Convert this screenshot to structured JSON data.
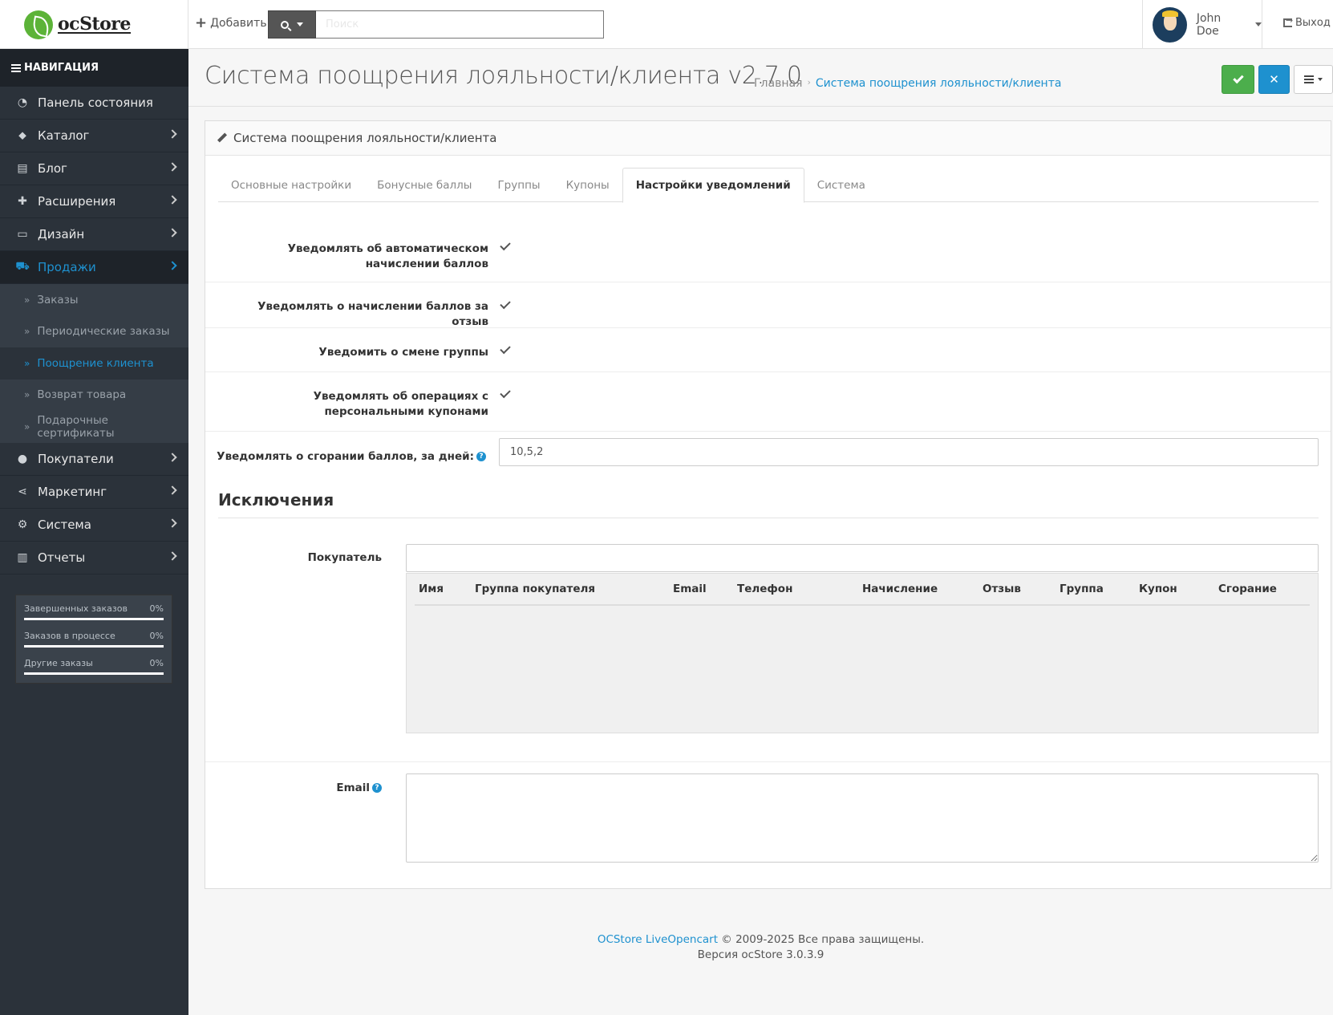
{
  "header": {
    "logo_text": "ocStore",
    "add_label": "Добавить",
    "search_placeholder": "Поиск",
    "user_name": "John Doe",
    "logout_label": "Выход"
  },
  "sidebar": {
    "nav_title": "НАВИГАЦИЯ",
    "items": [
      {
        "label": "Панель состояния",
        "icon": "dashboard-icon"
      },
      {
        "label": "Каталог",
        "icon": "tags-icon"
      },
      {
        "label": "Блог",
        "icon": "book-icon"
      },
      {
        "label": "Расширения",
        "icon": "puzzle-icon"
      },
      {
        "label": "Дизайн",
        "icon": "desktop-icon"
      },
      {
        "label": "Продажи",
        "icon": "cart-icon"
      },
      {
        "label": "Покупатели",
        "icon": "user-icon"
      },
      {
        "label": "Маркетинг",
        "icon": "share-icon"
      },
      {
        "label": "Система",
        "icon": "gear-icon"
      },
      {
        "label": "Отчеты",
        "icon": "bar-chart-icon"
      }
    ],
    "sales_sub": [
      "Заказы",
      "Периодические заказы",
      "Поощрение клиента",
      "Возврат товара",
      "Подарочные сертификаты"
    ],
    "stats": [
      {
        "label": "Завершенных заказов",
        "value": "0%"
      },
      {
        "label": "Заказов в процессе",
        "value": "0%"
      },
      {
        "label": "Другие заказы",
        "value": "0%"
      }
    ]
  },
  "page": {
    "title": "Система поощрения лояльности/клиента v2.7.0",
    "breadcrumb_home": "Главная",
    "breadcrumb_sep": "›",
    "breadcrumb_current": "Система поощрения лояльности/клиента",
    "panel_title": "Система поощрения лояльности/клиента"
  },
  "tabs": [
    "Основные настройки",
    "Бонусные баллы",
    "Группы",
    "Купоны",
    "Настройки уведомлений",
    "Система"
  ],
  "form": {
    "notify_auto": "Уведомлять об автоматическом начислении баллов",
    "notify_review": "Уведомлять о начислении баллов за отзыв",
    "notify_group": "Уведомить о смене группы",
    "notify_coupons": "Уведомлять об операциях с персональными купонами",
    "notify_expire_label": "Уведомлять о сгорании баллов, за дней:",
    "notify_expire_value": "10,5,2",
    "help_icon": "?",
    "exclusions_title": "Исключения",
    "customer_label": "Покупатель",
    "email_label": "Email"
  },
  "exclusions_table": {
    "columns": [
      "Имя",
      "Группа покупателя",
      "Email",
      "Телефон",
      "Начисление",
      "Отзыв",
      "Группа",
      "Купон",
      "Сгорание"
    ]
  },
  "footer": {
    "link": "OCStore LiveOpencart",
    "rights": " © 2009-2025 Все права защищены.",
    "version": "Версия ocStore 3.0.3.9"
  },
  "colors": {
    "accent": "#1e91cf",
    "success": "#4cae4c",
    "sidebar_bg": "#2b323a"
  }
}
